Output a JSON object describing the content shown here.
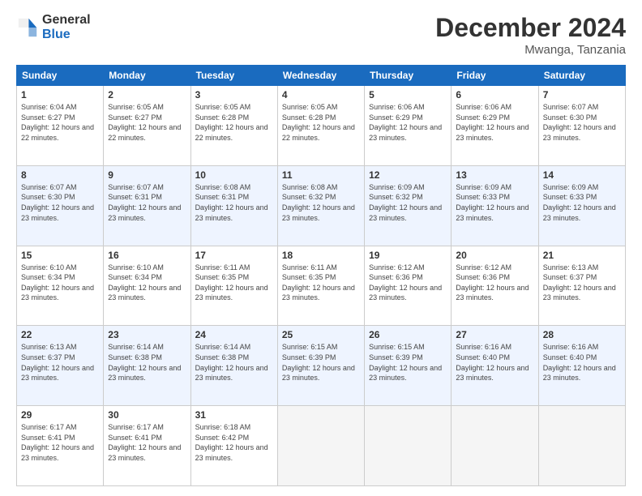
{
  "logo": {
    "general": "General",
    "blue": "Blue"
  },
  "title": "December 2024",
  "location": "Mwanga, Tanzania",
  "headers": [
    "Sunday",
    "Monday",
    "Tuesday",
    "Wednesday",
    "Thursday",
    "Friday",
    "Saturday"
  ],
  "weeks": [
    [
      {
        "day": "1",
        "sunrise": "6:04 AM",
        "sunset": "6:27 PM",
        "daylight": "12 hours and 22 minutes."
      },
      {
        "day": "2",
        "sunrise": "6:05 AM",
        "sunset": "6:27 PM",
        "daylight": "12 hours and 22 minutes."
      },
      {
        "day": "3",
        "sunrise": "6:05 AM",
        "sunset": "6:28 PM",
        "daylight": "12 hours and 22 minutes."
      },
      {
        "day": "4",
        "sunrise": "6:05 AM",
        "sunset": "6:28 PM",
        "daylight": "12 hours and 22 minutes."
      },
      {
        "day": "5",
        "sunrise": "6:06 AM",
        "sunset": "6:29 PM",
        "daylight": "12 hours and 23 minutes."
      },
      {
        "day": "6",
        "sunrise": "6:06 AM",
        "sunset": "6:29 PM",
        "daylight": "12 hours and 23 minutes."
      },
      {
        "day": "7",
        "sunrise": "6:07 AM",
        "sunset": "6:30 PM",
        "daylight": "12 hours and 23 minutes."
      }
    ],
    [
      {
        "day": "8",
        "sunrise": "6:07 AM",
        "sunset": "6:30 PM",
        "daylight": "12 hours and 23 minutes."
      },
      {
        "day": "9",
        "sunrise": "6:07 AM",
        "sunset": "6:31 PM",
        "daylight": "12 hours and 23 minutes."
      },
      {
        "day": "10",
        "sunrise": "6:08 AM",
        "sunset": "6:31 PM",
        "daylight": "12 hours and 23 minutes."
      },
      {
        "day": "11",
        "sunrise": "6:08 AM",
        "sunset": "6:32 PM",
        "daylight": "12 hours and 23 minutes."
      },
      {
        "day": "12",
        "sunrise": "6:09 AM",
        "sunset": "6:32 PM",
        "daylight": "12 hours and 23 minutes."
      },
      {
        "day": "13",
        "sunrise": "6:09 AM",
        "sunset": "6:33 PM",
        "daylight": "12 hours and 23 minutes."
      },
      {
        "day": "14",
        "sunrise": "6:09 AM",
        "sunset": "6:33 PM",
        "daylight": "12 hours and 23 minutes."
      }
    ],
    [
      {
        "day": "15",
        "sunrise": "6:10 AM",
        "sunset": "6:34 PM",
        "daylight": "12 hours and 23 minutes."
      },
      {
        "day": "16",
        "sunrise": "6:10 AM",
        "sunset": "6:34 PM",
        "daylight": "12 hours and 23 minutes."
      },
      {
        "day": "17",
        "sunrise": "6:11 AM",
        "sunset": "6:35 PM",
        "daylight": "12 hours and 23 minutes."
      },
      {
        "day": "18",
        "sunrise": "6:11 AM",
        "sunset": "6:35 PM",
        "daylight": "12 hours and 23 minutes."
      },
      {
        "day": "19",
        "sunrise": "6:12 AM",
        "sunset": "6:36 PM",
        "daylight": "12 hours and 23 minutes."
      },
      {
        "day": "20",
        "sunrise": "6:12 AM",
        "sunset": "6:36 PM",
        "daylight": "12 hours and 23 minutes."
      },
      {
        "day": "21",
        "sunrise": "6:13 AM",
        "sunset": "6:37 PM",
        "daylight": "12 hours and 23 minutes."
      }
    ],
    [
      {
        "day": "22",
        "sunrise": "6:13 AM",
        "sunset": "6:37 PM",
        "daylight": "12 hours and 23 minutes."
      },
      {
        "day": "23",
        "sunrise": "6:14 AM",
        "sunset": "6:38 PM",
        "daylight": "12 hours and 23 minutes."
      },
      {
        "day": "24",
        "sunrise": "6:14 AM",
        "sunset": "6:38 PM",
        "daylight": "12 hours and 23 minutes."
      },
      {
        "day": "25",
        "sunrise": "6:15 AM",
        "sunset": "6:39 PM",
        "daylight": "12 hours and 23 minutes."
      },
      {
        "day": "26",
        "sunrise": "6:15 AM",
        "sunset": "6:39 PM",
        "daylight": "12 hours and 23 minutes."
      },
      {
        "day": "27",
        "sunrise": "6:16 AM",
        "sunset": "6:40 PM",
        "daylight": "12 hours and 23 minutes."
      },
      {
        "day": "28",
        "sunrise": "6:16 AM",
        "sunset": "6:40 PM",
        "daylight": "12 hours and 23 minutes."
      }
    ],
    [
      {
        "day": "29",
        "sunrise": "6:17 AM",
        "sunset": "6:41 PM",
        "daylight": "12 hours and 23 minutes."
      },
      {
        "day": "30",
        "sunrise": "6:17 AM",
        "sunset": "6:41 PM",
        "daylight": "12 hours and 23 minutes."
      },
      {
        "day": "31",
        "sunrise": "6:18 AM",
        "sunset": "6:42 PM",
        "daylight": "12 hours and 23 minutes."
      },
      null,
      null,
      null,
      null
    ]
  ]
}
